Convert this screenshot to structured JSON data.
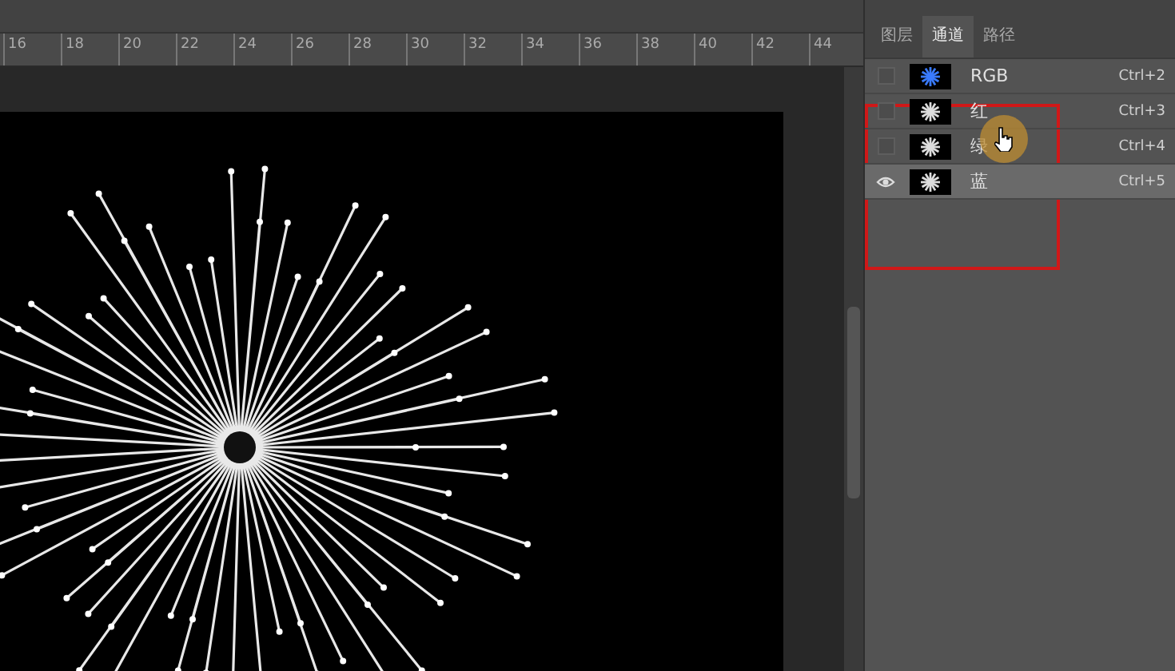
{
  "ruler": {
    "labels": [
      "16",
      "18",
      "20",
      "22",
      "24",
      "26",
      "28",
      "30",
      "32",
      "34",
      "36",
      "38",
      "40",
      "42",
      "44"
    ]
  },
  "panel": {
    "tabs": [
      {
        "label": "图层",
        "selected": false
      },
      {
        "label": "通道",
        "selected": true
      },
      {
        "label": "路径",
        "selected": false
      }
    ],
    "channels": [
      {
        "name": "RGB",
        "shortcut": "Ctrl+2",
        "visible": false,
        "selected": false,
        "kind": "composite"
      },
      {
        "name": "红",
        "shortcut": "Ctrl+3",
        "visible": false,
        "selected": false,
        "kind": "single"
      },
      {
        "name": "绿",
        "shortcut": "Ctrl+4",
        "visible": false,
        "selected": false,
        "kind": "single"
      },
      {
        "name": "蓝",
        "shortcut": "Ctrl+5",
        "visible": true,
        "selected": true,
        "kind": "single"
      }
    ]
  }
}
